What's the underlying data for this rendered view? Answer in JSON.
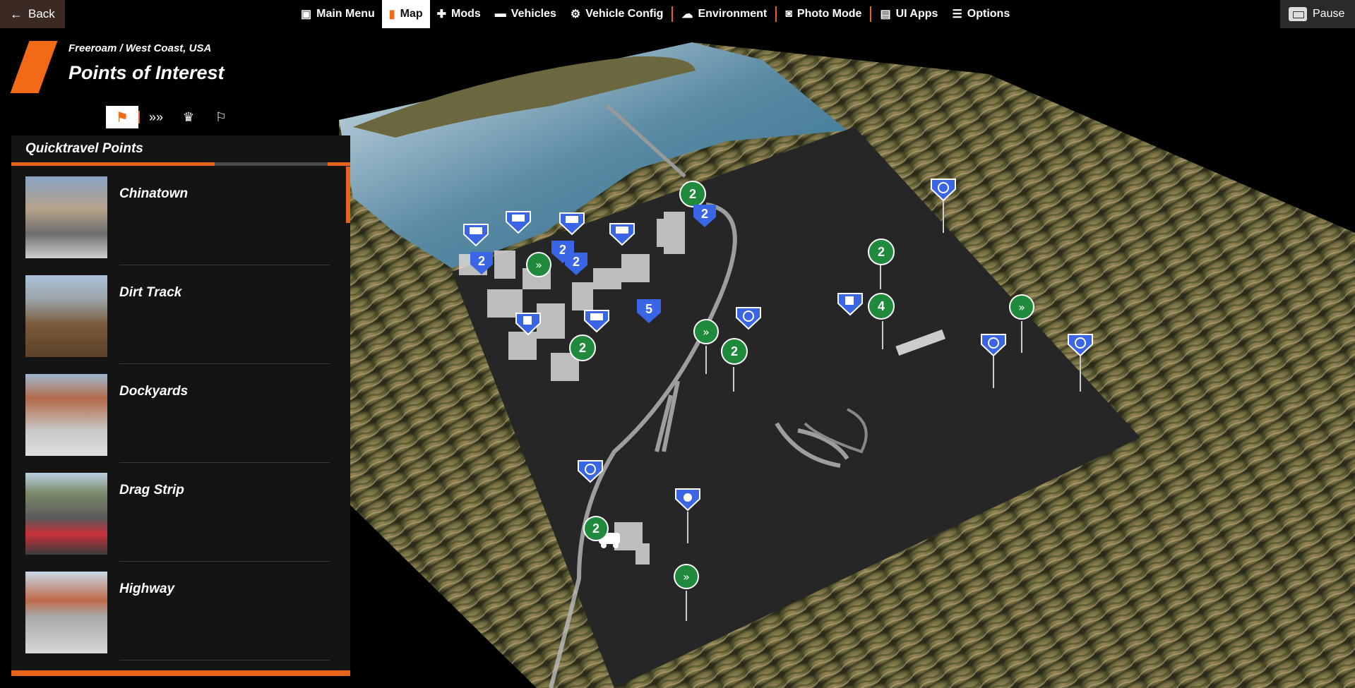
{
  "nav": {
    "back_label": "Back",
    "items": [
      {
        "label": "Main Menu",
        "icon": "main-menu-icon",
        "active": false
      },
      {
        "label": "Map",
        "icon": "map-icon",
        "active": true
      },
      {
        "label": "Mods",
        "icon": "puzzle-icon",
        "active": false
      },
      {
        "label": "Vehicles",
        "icon": "car-icon",
        "active": false
      },
      {
        "label": "Vehicle Config",
        "icon": "engine-icon",
        "active": false
      },
      {
        "label": "Environment",
        "icon": "weather-icon",
        "active": false
      },
      {
        "label": "Photo Mode",
        "icon": "camera-icon",
        "active": false
      },
      {
        "label": "UI Apps",
        "icon": "ui-apps-icon",
        "active": false
      },
      {
        "label": "Options",
        "icon": "sliders-icon",
        "active": false
      }
    ],
    "pause_label": "Pause"
  },
  "header": {
    "breadcrumb": "Freeroam / West Coast, USA",
    "title": "Points of Interest"
  },
  "tabs": [
    {
      "icon": "quicktravel-icon",
      "active": true
    },
    {
      "icon": "chevrons-icon",
      "active": false
    },
    {
      "icon": "trophy-icon",
      "active": false
    },
    {
      "icon": "flag-plus-icon",
      "active": false
    }
  ],
  "panel": {
    "title": "Quicktravel Points",
    "items": [
      {
        "label": "Chinatown"
      },
      {
        "label": "Dirt Track"
      },
      {
        "label": "Dockyards"
      },
      {
        "label": "Drag Strip"
      },
      {
        "label": "Highway"
      }
    ]
  },
  "colors": {
    "accent": "#f26a16",
    "marker_blue": "#3a66e6",
    "marker_green": "#1f8a3c"
  },
  "markers": {
    "numbered": [
      "2",
      "2",
      "2",
      "2",
      "2",
      "5",
      "2",
      "2",
      "2",
      "4"
    ]
  }
}
